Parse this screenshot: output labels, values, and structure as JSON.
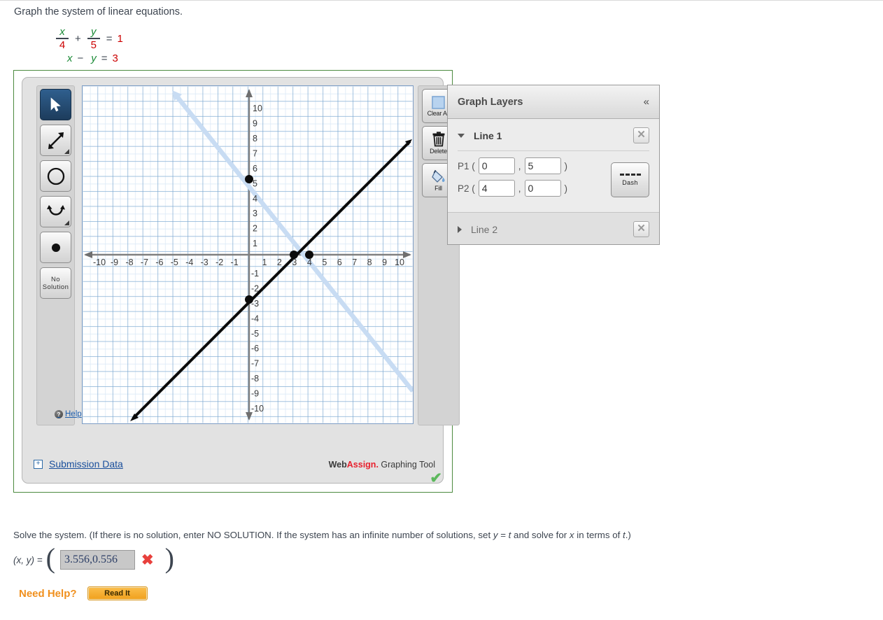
{
  "prompt": "Graph the system of linear equations.",
  "equations": {
    "eq1": {
      "num_x": "x",
      "den_x": "4",
      "plus": "+",
      "num_y": "y",
      "den_y": "5",
      "equals": "=",
      "rhs": "1"
    },
    "eq2": {
      "x": "x",
      "minus": "−",
      "y": "y",
      "equals": "=",
      "rhs": "3"
    }
  },
  "graphing_tool": {
    "brand_pre": "Web",
    "brand_red": "Assign.",
    "brand_post": " Graphing Tool",
    "left_toolbar": [
      {
        "name": "pointer-tool",
        "label": "",
        "icon": "cursor-arrow-icon",
        "selected": true
      },
      {
        "name": "line-tool",
        "label": "",
        "icon": "double-arrow-line-icon",
        "selected": false
      },
      {
        "name": "circle-tool",
        "label": "",
        "icon": "circle-icon",
        "selected": false
      },
      {
        "name": "parabola-tool",
        "label": "",
        "icon": "parabola-icon",
        "selected": false
      },
      {
        "name": "point-tool",
        "label": "",
        "icon": "filled-dot-icon",
        "selected": false
      },
      {
        "name": "no-solution-tool",
        "label": "No Solution",
        "icon": "text-button",
        "selected": false
      }
    ],
    "help_label": "Help",
    "right_toolbar": [
      {
        "name": "clear-all-button",
        "label": "Clear All",
        "icon": "blue-square-icon"
      },
      {
        "name": "delete-button",
        "label": "Delete",
        "icon": "trash-can-icon"
      },
      {
        "name": "fill-button",
        "label": "Fill",
        "icon": "paint-bucket-icon"
      }
    ]
  },
  "graph": {
    "x_ticks": [
      "-10",
      "-9",
      "-8",
      "-7",
      "-6",
      "-5",
      "-4",
      "-3",
      "-2",
      "-1",
      "1",
      "2",
      "3",
      "4",
      "5",
      "6",
      "7",
      "8",
      "9",
      "10"
    ],
    "y_ticks": [
      "10",
      "9",
      "8",
      "7",
      "6",
      "5",
      "4",
      "3",
      "2",
      "1",
      "-1",
      "-2",
      "-3",
      "-4",
      "-5",
      "-6",
      "-7",
      "-8",
      "-9",
      "-10"
    ],
    "xlim": [
      -11,
      11
    ],
    "ylim": [
      -11,
      11
    ],
    "lines": [
      {
        "name": "Line 1",
        "p1": [
          0,
          5
        ],
        "p2": [
          4,
          0
        ],
        "color": "#c6dcf5",
        "style": "solid-thick",
        "points_shown": [
          [
            0,
            5
          ],
          [
            4,
            0
          ]
        ]
      },
      {
        "name": "Line 2",
        "p1": [
          0,
          -3
        ],
        "p2": [
          3,
          0
        ],
        "color": "#000000",
        "style": "solid-thick",
        "points_shown": [
          [
            0,
            -3
          ],
          [
            3,
            0
          ]
        ]
      }
    ],
    "grid_color_major": "#7ba5d0",
    "grid_color_minor": "#d7e7f5",
    "axis_color": "#7b7b7b"
  },
  "layers_panel": {
    "title": "Graph Layers",
    "collapse_icon": "«",
    "items": [
      {
        "name": "Line 1",
        "expanded": true,
        "p1_label": "P1 (",
        "p2_label": "P2 (",
        "comma": ",",
        "close_paren": ")",
        "p1_x": "0",
        "p1_y": "5",
        "p2_x": "4",
        "p2_y": "0",
        "style_button": "Dash"
      },
      {
        "name": "Line 2",
        "expanded": false
      }
    ]
  },
  "submission": {
    "expand_icon": "+",
    "link_label": "Submission Data",
    "status_icon": "green-check"
  },
  "solve": {
    "instruction_a": "Solve the system. (If there is no solution, enter NO SOLUTION. If the system has an infinite number of solutions, set ",
    "instruction_y": "y",
    "instruction_eq": " = ",
    "instruction_t": "t",
    "instruction_b": " and solve for ",
    "instruction_x": "x",
    "instruction_c": " in terms of ",
    "instruction_t2": "t",
    "instruction_d": ".)",
    "answer_label": "(x, y) =",
    "answer_value": "3.556,0.556",
    "mark": "✖"
  },
  "help": {
    "need_help_label": "Need Help?",
    "read_it_label": "Read It"
  }
}
